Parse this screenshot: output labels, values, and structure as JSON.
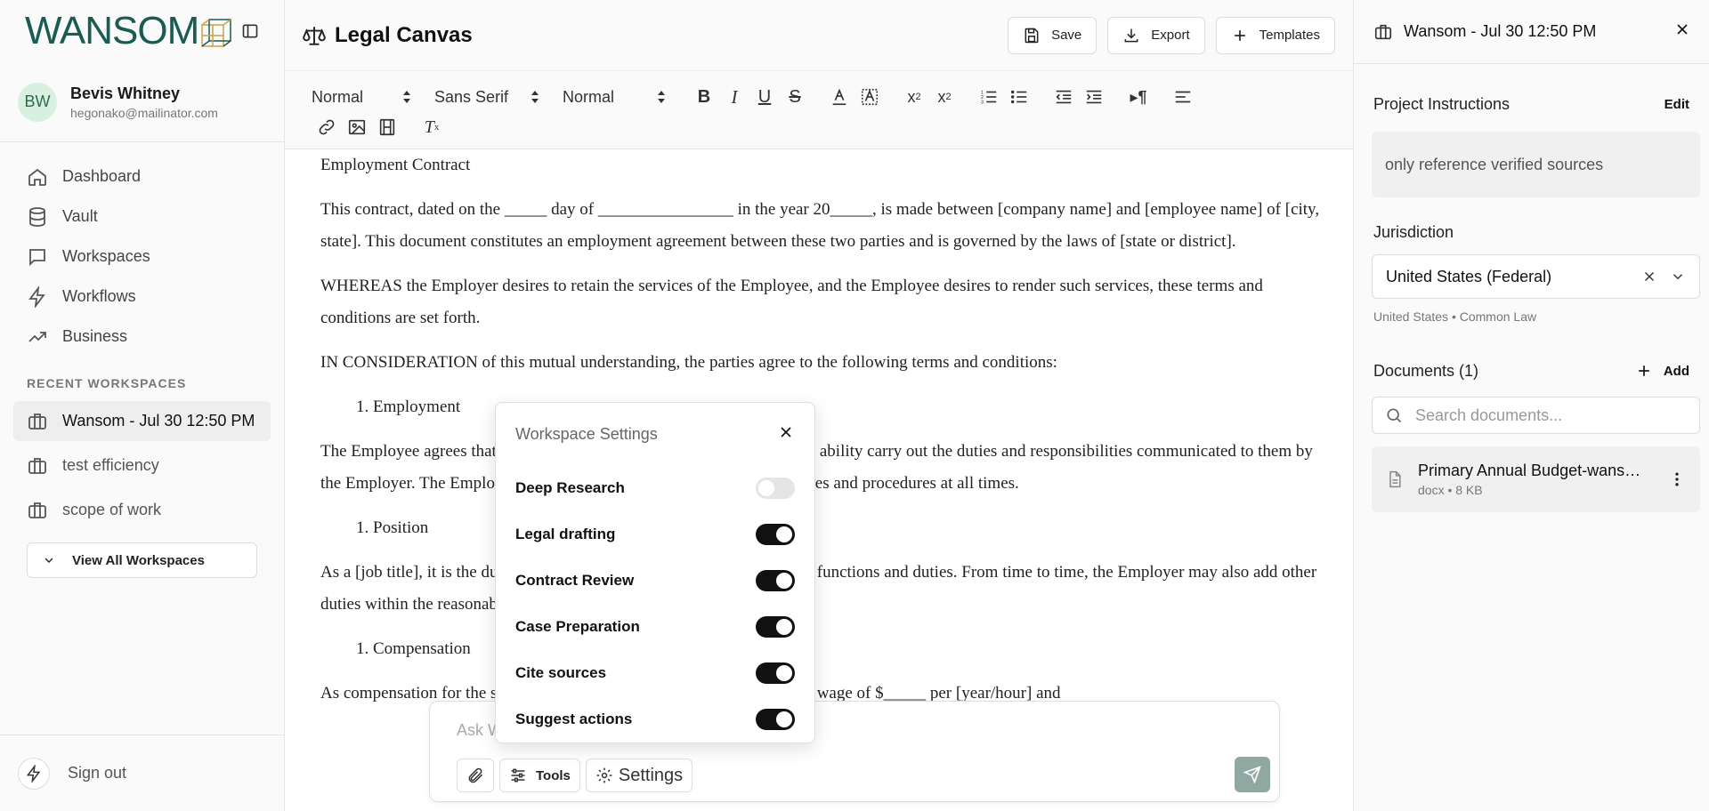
{
  "brand": {
    "logo_text": "WANSOM"
  },
  "user": {
    "initials": "BW",
    "name": "Bevis Whitney",
    "email": "hegonako@mailinator.com"
  },
  "nav": [
    {
      "label": "Dashboard",
      "icon": "home-icon"
    },
    {
      "label": "Vault",
      "icon": "database-icon"
    },
    {
      "label": "Workspaces",
      "icon": "chat-icon"
    },
    {
      "label": "Workflows",
      "icon": "lightning-icon"
    },
    {
      "label": "Business",
      "icon": "trend-icon"
    }
  ],
  "recent": {
    "label": "RECENT WORKSPACES",
    "items": [
      {
        "label": "Wansom - Jul 30 12:50 PM",
        "active": true
      },
      {
        "label": "test efficiency",
        "active": false
      },
      {
        "label": "scope of work",
        "active": false
      }
    ],
    "view_all": "View All Workspaces"
  },
  "signout": "Sign out",
  "main": {
    "title": "Legal Canvas",
    "save": "Save",
    "export": "Export",
    "templates": "Templates"
  },
  "toolbar": {
    "heading_select": "Normal",
    "font_select": "Sans Serif",
    "size_select": "Normal"
  },
  "document": {
    "heading": "Employment Contract",
    "p1": "This contract, dated on the _____ day of ________________ in the year 20_____, is made between [company name] and [employee name] of [city, state]. This document constitutes an employment agreement between these two parties and is governed by the laws of [state or district].",
    "p2": "WHEREAS the Employer desires to retain the services of the Employee, and the Employee desires to render such services, these terms and conditions are set forth.",
    "p3": "IN CONSIDERATION of this mutual understanding, the parties agree to the following terms and conditions:",
    "li1": "1. Employment",
    "p4": "The Employee agrees that he or she will faithfully and to the best of their ability carry out the duties and responsibilities communicated to them by the Employer. The Employee shall comply with all company policies, rules and procedures at all times.",
    "li2": "1. Position",
    "p5": "As a [job title], it is the duty of the Employee to perform all essential job functions and duties. From time to time, the Employer may also add other duties within the reasonable scope of the Employee's work.",
    "li3": "1. Compensation",
    "p6": "As compensation for the services provided, the Employee shall be paid a wage of $_____ per [year/hour] and"
  },
  "chat": {
    "placeholder": "Ask Wansom anything...",
    "tools_label": "Tools",
    "settings_label": "Settings"
  },
  "popup": {
    "title": "Workspace Settings",
    "settings": [
      {
        "label": "Deep Research",
        "on": false
      },
      {
        "label": "Legal drafting",
        "on": true
      },
      {
        "label": "Contract Review",
        "on": true
      },
      {
        "label": "Case Preparation",
        "on": true
      },
      {
        "label": "Cite sources",
        "on": true
      },
      {
        "label": "Suggest actions",
        "on": true
      }
    ]
  },
  "right_panel": {
    "title": "Wansom - Jul 30 12:50 PM",
    "instructions_label": "Project Instructions",
    "edit": "Edit",
    "instructions": "only reference verified sources",
    "jurisdiction_label": "Jurisdiction",
    "jurisdiction_value": "United States (Federal)",
    "jurisdiction_sub": "United States • Common Law",
    "documents_label": "Documents (1)",
    "add": "Add",
    "search_placeholder": "Search documents...",
    "doc_name": "Primary Annual Budget-wansom.docx",
    "doc_meta": "docx • 8 KB"
  },
  "colors": {
    "brand": "#1a5c52",
    "toggle_on": "#111111",
    "send_button": "#8fa8a2",
    "avatar_bg": "#d8f0e0"
  }
}
